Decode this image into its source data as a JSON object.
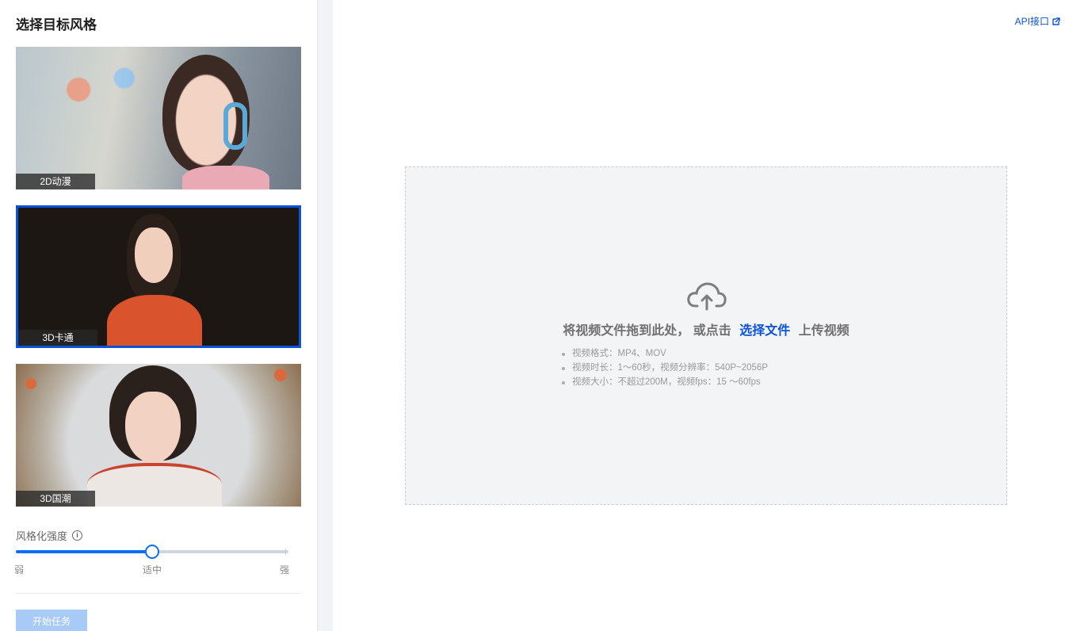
{
  "sidebar": {
    "title": "选择目标风格",
    "styles": [
      {
        "label": "2D动漫",
        "selected": false
      },
      {
        "label": "3D卡通",
        "selected": true
      },
      {
        "label": "3D国潮",
        "selected": false
      }
    ],
    "strength": {
      "label": "风格化强度",
      "value_fraction": 0.5,
      "ticks": {
        "weak": "弱",
        "mid": "适中",
        "strong": "强"
      }
    },
    "start_button": "开始任务"
  },
  "header": {
    "api_link": "API接口"
  },
  "upload": {
    "prompt_prefix": "将视频文件拖到此处，",
    "prompt_middle": "或点击",
    "select_link": "选择文件",
    "prompt_suffix": "上传视频",
    "requirements": [
      "视频格式：MP4、MOV",
      "视频时长：1～60秒，视频分辨率：540P~2056P",
      "视频大小：不超过200M，视频fps：15 ～60fps"
    ]
  },
  "colors": {
    "accent": "#0b52d8",
    "slider": "#0b6ef5",
    "button_disabled": "#a8caf7"
  }
}
